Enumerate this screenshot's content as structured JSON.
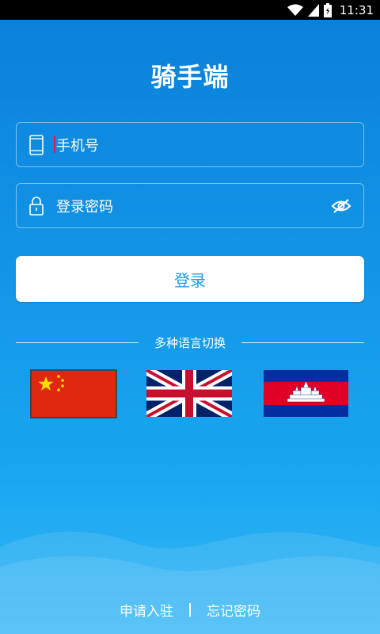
{
  "status_bar": {
    "time": "11:31",
    "icons": [
      "wifi-icon",
      "signal-icon",
      "battery-icon"
    ]
  },
  "title": "骑手端",
  "phone_field": {
    "placeholder": "手机号",
    "icon": "phone-icon"
  },
  "password_field": {
    "placeholder": "登录密码",
    "icon": "lock-icon",
    "toggle_icon": "eye-off-icon"
  },
  "login_button": "登录",
  "language": {
    "label": "多种语言切换",
    "options": [
      "china-flag",
      "uk-flag",
      "cambodia-flag"
    ]
  },
  "bottom_links": {
    "apply": "申请入驻",
    "forgot": "忘记密码"
  },
  "colors": {
    "background_top": "#0a7fd9",
    "background_bottom": "#35b6f5",
    "button_text": "#1a9ce6",
    "cursor": "#d81b60"
  }
}
